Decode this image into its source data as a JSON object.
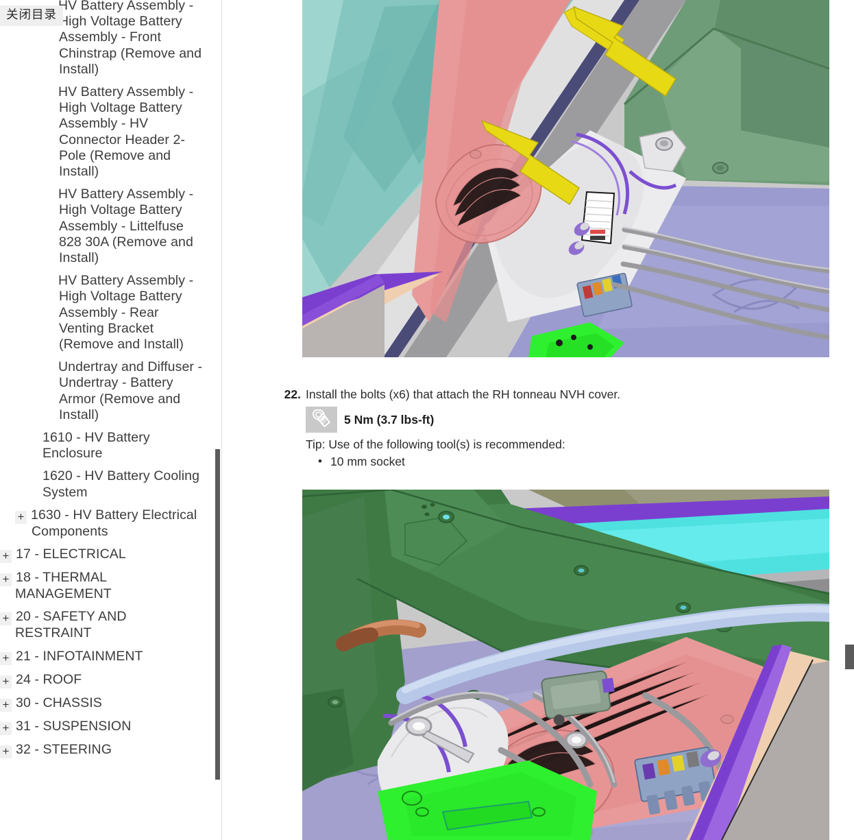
{
  "toc": {
    "close_button_label": "关闭目录",
    "items": [
      {
        "label": "HV Battery Assembly - High Voltage Battery Assembly - Front Chinstrap (Remove and Install)",
        "level": "deep",
        "expandable": false
      },
      {
        "label": "HV Battery Assembly - High Voltage Battery Assembly - HV Connector Header 2-Pole (Remove and Install)",
        "level": "deep",
        "expandable": false
      },
      {
        "label": "HV Battery Assembly - High Voltage Battery Assembly - Littelfuse 828 30A (Remove and Install)",
        "level": "deep",
        "expandable": false
      },
      {
        "label": "HV Battery Assembly - High Voltage Battery Assembly - Rear Venting Bracket (Remove and Install)",
        "level": "deep",
        "expandable": false
      },
      {
        "label": "Undertray and Diffuser - Undertray - Battery Armor (Remove and Install)",
        "level": "deep",
        "expandable": false
      },
      {
        "label": "1610 - HV Battery Enclosure",
        "level": "mid",
        "expandable": false
      },
      {
        "label": "1620 - HV Battery Cooling System",
        "level": "mid",
        "expandable": false
      },
      {
        "label": "1630 - HV Battery Electrical Components",
        "level": "midplus",
        "expandable": true
      },
      {
        "label": "17 - ELECTRICAL",
        "level": "top",
        "expandable": true
      },
      {
        "label": "18 - THERMAL MANAGEMENT",
        "level": "top",
        "expandable": true
      },
      {
        "label": "20 - SAFETY AND RESTRAINT",
        "level": "top",
        "expandable": true
      },
      {
        "label": "21 - INFOTAINMENT",
        "level": "top",
        "expandable": true
      },
      {
        "label": "24 - ROOF",
        "level": "top",
        "expandable": true
      },
      {
        "label": "30 - CHASSIS",
        "level": "top",
        "expandable": true
      },
      {
        "label": "31 - SUSPENSION",
        "level": "top",
        "expandable": true
      },
      {
        "label": "32 - STEERING",
        "level": "top",
        "expandable": true
      }
    ],
    "expand_glyph": "+"
  },
  "step": {
    "number": "22.",
    "text": "Install the bolts (x6) that attach the RH tonneau NVH cover.",
    "torque": "5 Nm (3.7 lbs-ft)",
    "torque_icon": "bolt-icon",
    "tip": "Tip: Use of the following tool(s) is recommended:",
    "tools": [
      "10 mm socket"
    ]
  },
  "figures": [
    {
      "name": "rh-tonneau-nvh-cover-installed-view",
      "caption": "",
      "annotation_arrows": 2,
      "arrow_color": "#e8d915"
    },
    {
      "name": "rh-tonneau-nvh-cover-bolt-locations-view",
      "caption": "",
      "annotation_arrows": 0,
      "arrow_color": "#e8d915"
    }
  ],
  "colors": {
    "arrow_yellow": "#e8d915",
    "scrollbar": "#5b5b5b",
    "figure_bg": "#c9c9ca",
    "text": "#2b2b2b",
    "toc_border": "#e3e3e6"
  }
}
